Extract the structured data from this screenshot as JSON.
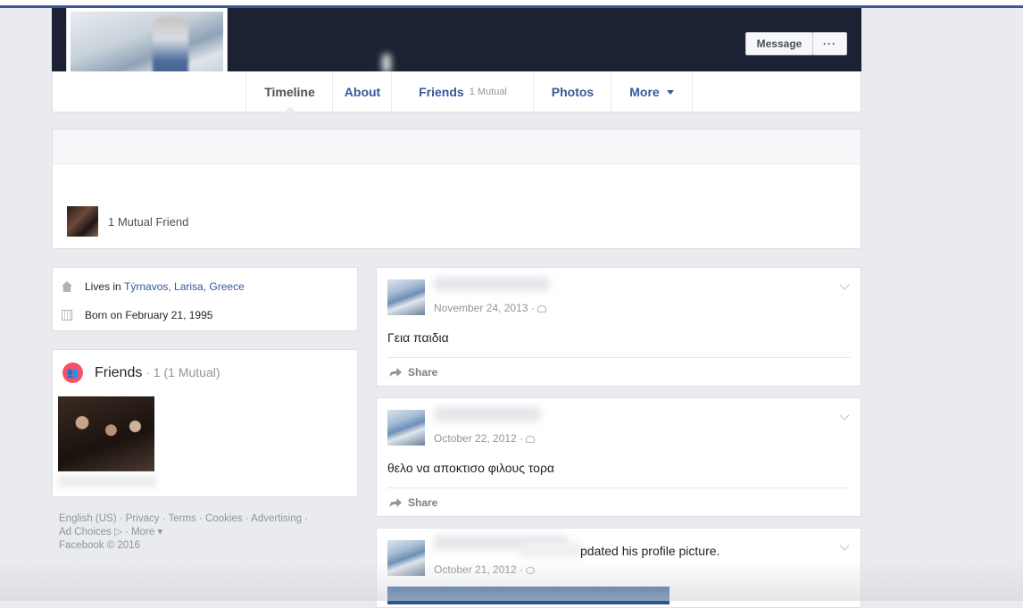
{
  "header": {
    "buttons": {
      "message": "Message",
      "more": "···"
    },
    "tabs": [
      {
        "label": "Timeline",
        "sub": ""
      },
      {
        "label": "About",
        "sub": ""
      },
      {
        "label": "Friends",
        "sub": "1 Mutual"
      },
      {
        "label": "Photos",
        "sub": ""
      },
      {
        "label": "More",
        "sub": ""
      }
    ]
  },
  "intro": {
    "mutual_text": "1 Mutual Friend"
  },
  "about": {
    "lives_prefix": "Lives in ",
    "location_link": "Týrnavos, Larisa, Greece",
    "born": "Born on February 21, 1995"
  },
  "friends": {
    "title": "Friends",
    "count": " · 1 (1 Mutual)"
  },
  "footer": {
    "line1": "English (US) · Privacy · Terms · Cookies · Advertising ·",
    "line2": "Ad Choices ▷ · More ▾",
    "line3": "Facebook © 2016"
  },
  "posts": [
    {
      "date": "November 24, 2013 ·",
      "text": "Γεια παιδια",
      "share": "Share"
    },
    {
      "date": "October 22, 2012 ·",
      "text": "θελο να αποκτισο φιλους τορα",
      "share": "Share"
    },
    {
      "date": "October 21, 2012 ·",
      "action": "pdated his profile picture."
    }
  ],
  "colors": {
    "accent": "#3b5998",
    "link": "#365899",
    "friends_icon": "#f35369"
  }
}
